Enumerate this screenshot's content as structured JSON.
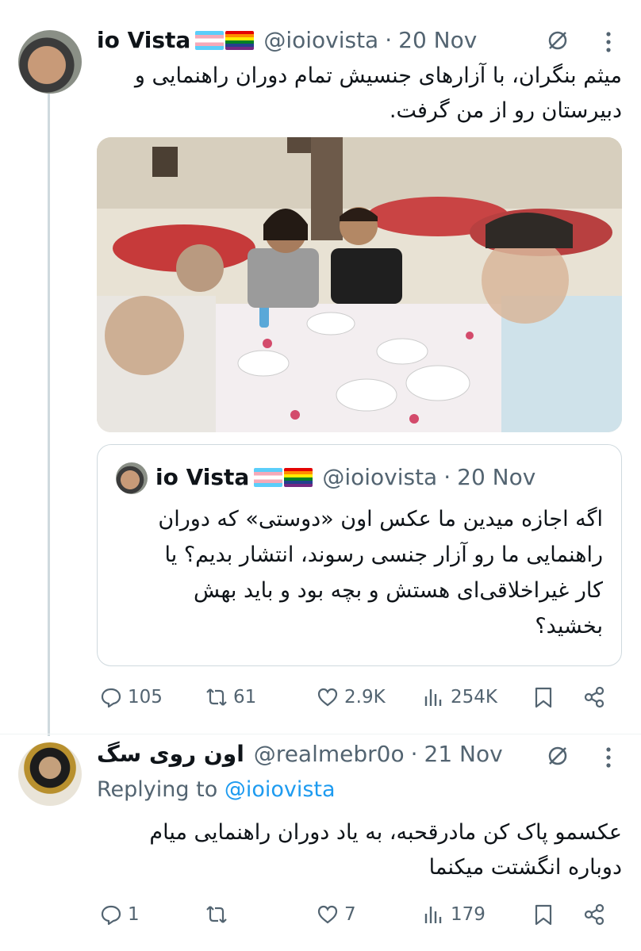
{
  "main_tweet": {
    "display_name": "io Vista",
    "handle": "@ioiovista",
    "separator": "·",
    "date": "20 Nov",
    "text_line1": "میثم بنگران، با آزارهای جنسیش تمام دوران راهنمایی و",
    "text_line2": "دبیرستان رو از من گرفت.",
    "quoted": {
      "display_name": "io Vista",
      "handle": "@ioiovista",
      "separator": "·",
      "date": "20 Nov",
      "line1": "اگه اجازه میدین ما عکس اون «دوستی» که دوران",
      "line2": "راهنمایی ما رو آزار جنسی رسوند، انتشار بدیم؟ یا",
      "line3": "کار غیراخلاقی‌ای هستش و بچه بود و باید بهش",
      "line4": "بخشید؟"
    },
    "stats": {
      "replies": "105",
      "retweets": "61",
      "likes": "2.9K",
      "views": "254K"
    }
  },
  "reply_tweet": {
    "display_name": "اون روی سگ",
    "handle": "@realmebr0o",
    "separator": "·",
    "date": "21 Nov",
    "replying_prefix": "Replying to",
    "replying_handle": "@ioiovista",
    "text_line1": "عکسمو پاک کن مادرقحبه، به یاد دوران راهنمایی میام",
    "text_line2": "دوباره انگشتت میکنما",
    "stats": {
      "replies": "1",
      "retweets": "",
      "likes": "7",
      "views": "179"
    }
  },
  "icons": [
    "grok-icon",
    "more-icon",
    "reply-icon",
    "retweet-icon",
    "like-icon",
    "views-icon",
    "bookmark-icon",
    "share-icon"
  ],
  "colors": {
    "text": "#0f1419",
    "secondary": "#536471",
    "link": "#1d9bf0",
    "border": "#cfd9de"
  }
}
